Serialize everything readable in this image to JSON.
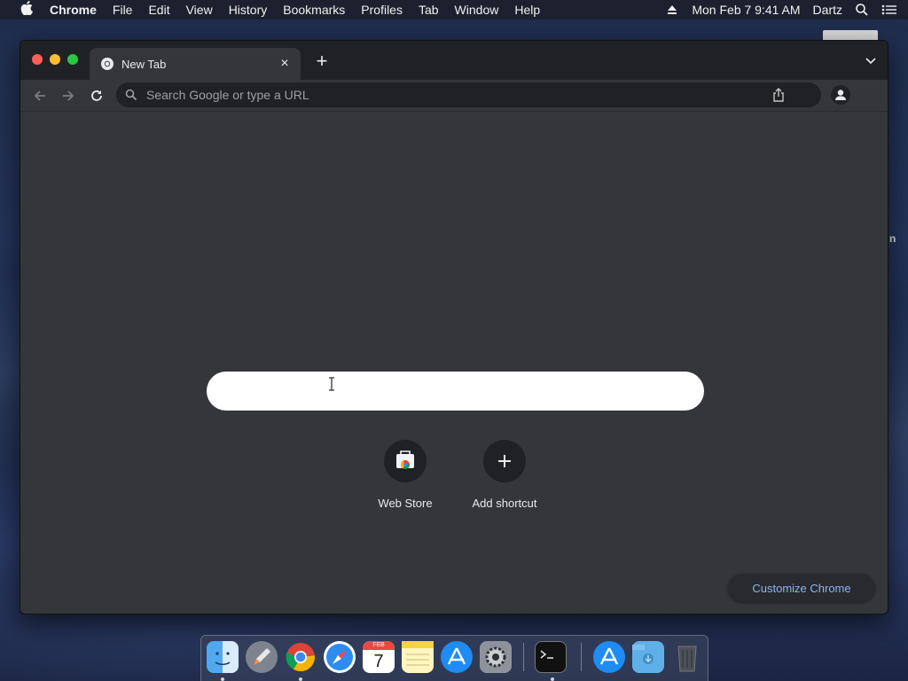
{
  "menubar": {
    "app_name": "Chrome",
    "items": [
      "File",
      "Edit",
      "View",
      "History",
      "Bookmarks",
      "Profiles",
      "Tab",
      "Window",
      "Help"
    ],
    "datetime": "Mon Feb 7  9:41 AM",
    "user": "Dartz"
  },
  "desktop": {
    "partial_label": "n"
  },
  "browser": {
    "tab": {
      "title": "New Tab",
      "favicon": "chrome-icon"
    },
    "omnibox": {
      "placeholder": "Search Google or type a URL"
    },
    "ntp": {
      "search_value": "",
      "shortcuts": [
        {
          "label": "Web Store",
          "icon": "web-store-icon"
        },
        {
          "label": "Add shortcut",
          "icon": "plus-icon"
        }
      ],
      "customize_label": "Customize Chrome"
    }
  },
  "dock": {
    "apps": [
      "finder-icon",
      "launchpad-icon",
      "chrome-icon",
      "safari-icon",
      "calendar-icon",
      "notes-icon",
      "app-store-icon",
      "system-preferences-icon",
      "terminal-icon",
      "applications-folder-icon",
      "downloads-folder-icon",
      "trash-icon"
    ],
    "calendar": {
      "month": "FEB",
      "day": "7"
    }
  },
  "colors": {
    "window_bg": "#35363a",
    "tabstrip_bg": "#202124",
    "link_blue": "#8ab4f8"
  }
}
